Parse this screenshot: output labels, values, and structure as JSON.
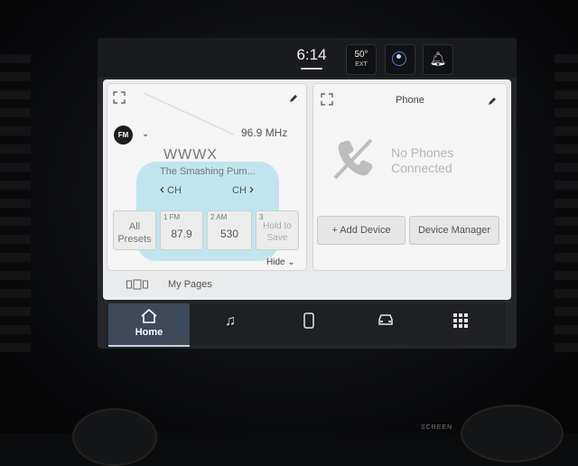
{
  "status_bar": {
    "time": "6:14",
    "temperature": "50°",
    "temperature_label": "EXT"
  },
  "radio_card": {
    "band": "FM",
    "frequency": "96.9 MHz",
    "station": "WWWX",
    "song": "The Smashing Pum...",
    "ch_prev_label": "CH",
    "ch_next_label": "CH",
    "presets": [
      {
        "label": "All\nPresets"
      },
      {
        "number": "1 FM",
        "value": "87.9"
      },
      {
        "number": "2 AM",
        "value": "530"
      },
      {
        "number": "3",
        "value": "Hold to\nSave"
      }
    ],
    "hide_label": "Hide"
  },
  "phone_card": {
    "title": "Phone",
    "status_line1": "No Phones",
    "status_line2": "Connected",
    "add_device_label": "+ Add Device",
    "device_manager_label": "Device Manager"
  },
  "my_pages": {
    "label": "My Pages"
  },
  "bottom_nav": {
    "home_label": "Home",
    "items": [
      "home-icon",
      "music-icon",
      "phone-icon",
      "vehicle-icon",
      "apps-grid-icon"
    ]
  },
  "colors": {
    "accent_glow": "#82d2e6",
    "nav_active": "#3c4a5a"
  },
  "bezel": {
    "screen_label": "SCREEN"
  }
}
